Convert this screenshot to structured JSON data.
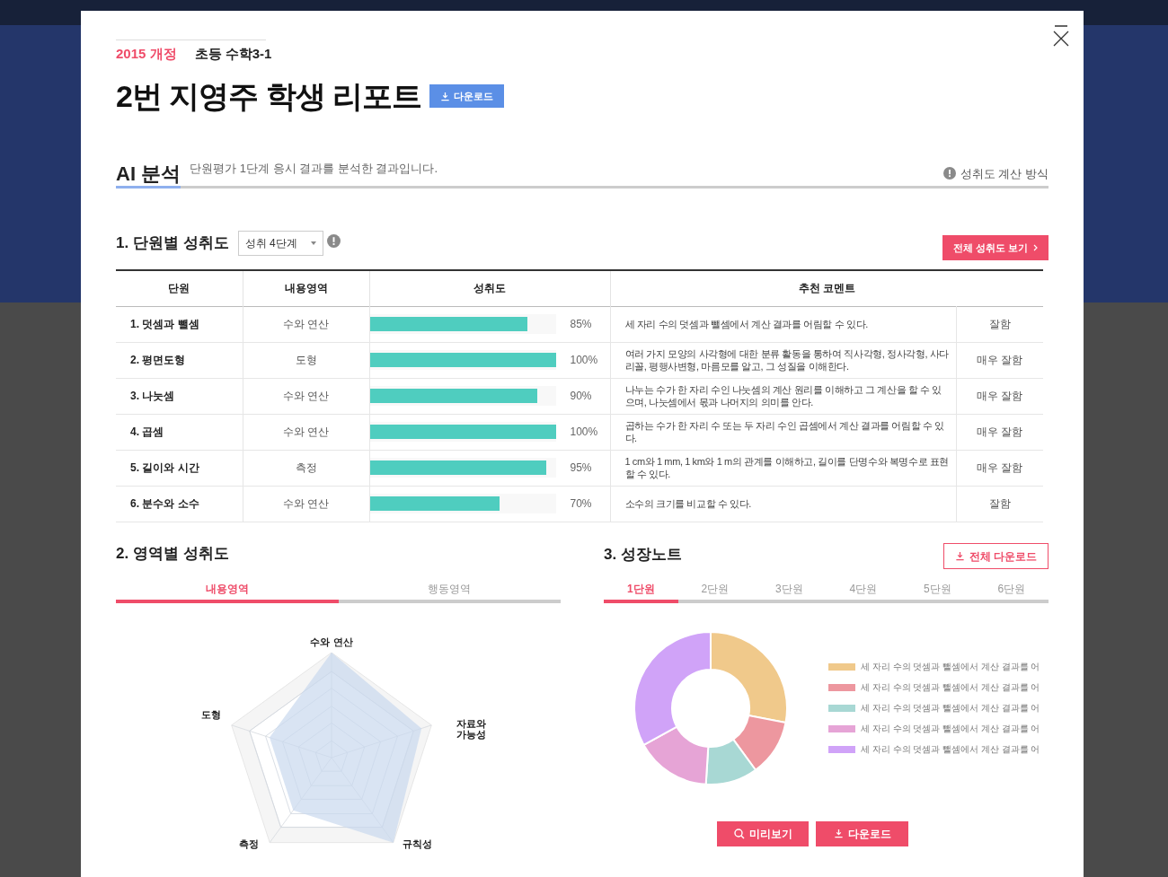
{
  "header": {
    "edition": "2015 개정",
    "subject": "초등 수학3-1",
    "title": "2번 지영주 학생 리포트",
    "download": "다운로드"
  },
  "analysis": {
    "title": "AI 분석",
    "description": "단원평가 1단계 응시 결과를 분석한 결과입니다.",
    "method_link": "성취도 계산 방식"
  },
  "unit_achievement": {
    "title": "1. 단원별 성취도",
    "select": "성취 4단계",
    "all_button": "전체 성취도 보기",
    "columns": [
      "단원",
      "내용영역",
      "성취도",
      "추천 코멘트"
    ],
    "rows": [
      {
        "unit": "1. 덧셈과 뺄셈",
        "area": "수와 연산",
        "level": 0.85,
        "percent": "85%",
        "comment": "세 자리 수의 덧셈과 뺄셈에서 계산 결과를 어림할 수 있다.",
        "grade": "잘함"
      },
      {
        "unit": "2. 평면도형",
        "area": "도형",
        "level": 1,
        "percent": "100%",
        "comment": "여러 가지 모양의 사각형에 대한 분류 활동을 통하여 직사각형, 정사각형, 사다리꼴, 평행사변형, 마름모를 알고, 그 성질을 이해한다.",
        "grade": "매우 잘함"
      },
      {
        "unit": "3. 나눗셈",
        "area": "수와 연산",
        "level": 0.9,
        "percent": "90%",
        "comment": "나누는 수가 한 자리 수인 나눗셈의 계산 원리를 이해하고 그 계산을 할 수 있으며, 나눗셈에서 몫과 나머지의 의미를 안다.",
        "grade": "매우 잘함"
      },
      {
        "unit": "4. 곱셈",
        "area": "수와 연산",
        "level": 1,
        "percent": "100%",
        "comment": "곱하는 수가 한 자리 수 또는 두 자리 수인 곱셈에서 계산 결과를 어림할 수 있다.",
        "grade": "매우 잘함"
      },
      {
        "unit": "5. 길이와 시간",
        "area": "측정",
        "level": 0.95,
        "percent": "95%",
        "comment": "1 cm와 1 mm, 1 km와 1 m의 관계를 이해하고, 길이를 단명수와 복명수로 표현할 수 있다.",
        "grade": "매우 잘함"
      },
      {
        "unit": "6. 분수와 소수",
        "area": "수와 연산",
        "level": 0.7,
        "percent": "70%",
        "comment": "소수의 크기를 비교할 수 있다.",
        "grade": "잘함"
      }
    ]
  },
  "area_achievement": {
    "title": "2. 영역별 성취도",
    "tabs": [
      {
        "label": "내용영역",
        "selected": true
      },
      {
        "label": "행동영역",
        "selected": false
      }
    ],
    "radar_labels": [
      "수와 연산",
      "자료와 가능성",
      "규칙성",
      "측정",
      "도형"
    ]
  },
  "growth_note": {
    "title": "3. 성장노트",
    "download_all": "전체 다운로드",
    "tabs": [
      {
        "label": "1단원",
        "selected": true
      },
      {
        "label": "2단원",
        "selected": false
      },
      {
        "label": "3단원",
        "selected": false
      },
      {
        "label": "4단원",
        "selected": false
      },
      {
        "label": "5단원",
        "selected": false
      },
      {
        "label": "6단원",
        "selected": false
      }
    ],
    "legend": [
      {
        "label": "세 자리 수의 덧셈과 뺄셈에서 계산 결과를 어",
        "color": "#f0c98b"
      },
      {
        "label": "세 자리 수의 덧셈과 뺄셈에서 계산 결과를 어",
        "color": "#ed979f"
      },
      {
        "label": "세 자리 수의 덧셈과 뺄셈에서 계산 결과를 어",
        "color": "#a8d8d4"
      },
      {
        "label": "세 자리 수의 덧셈과 뺄셈에서 계산 결과를 어",
        "color": "#e6a4d6"
      },
      {
        "label": "세 자리 수의 덧셈과 뺄셈에서 계산 결과를 어",
        "color": "#d0a3f8"
      }
    ],
    "preview_button": "미리보기",
    "download_button": "다운로드"
  }
}
